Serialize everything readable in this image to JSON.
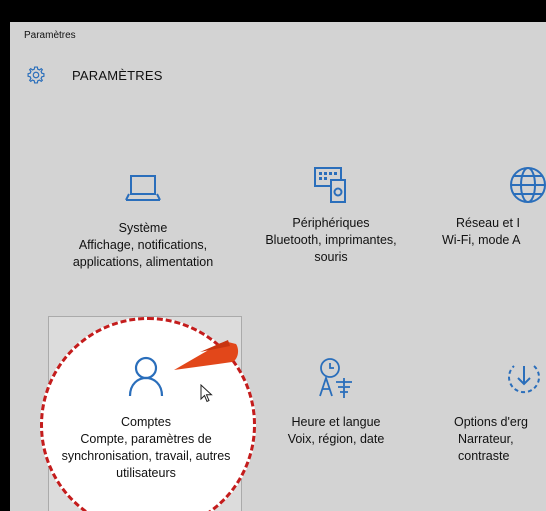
{
  "window": {
    "title": "Paramètres"
  },
  "header": {
    "title": "PARAMÈTRES",
    "icon": "gear-icon"
  },
  "tiles": [
    {
      "name": "Système",
      "desc": "Affichage, notifications, applications, alimentation",
      "icon": "laptop-icon"
    },
    {
      "name": "Périphériques",
      "desc": "Bluetooth, imprimantes, souris",
      "icon": "keyboard-icon"
    },
    {
      "name": "Réseau et I",
      "desc": "Wi-Fi, mode A",
      "icon": "globe-icon"
    },
    {
      "name": "Comptes",
      "desc": "Compte, paramètres de synchronisation, travail, autres utilisateurs",
      "icon": "person-icon"
    },
    {
      "name": "Heure et langue",
      "desc": "Voix, région, date",
      "icon": "time-language-icon"
    },
    {
      "name": "Options d'erg",
      "desc": "Narrateur, contraste",
      "icon": "ease-of-access-icon"
    }
  ],
  "colors": {
    "accent": "#2a6ebb",
    "highlight_border": "#c41c1c",
    "pointer_hand": "#e2471a"
  }
}
